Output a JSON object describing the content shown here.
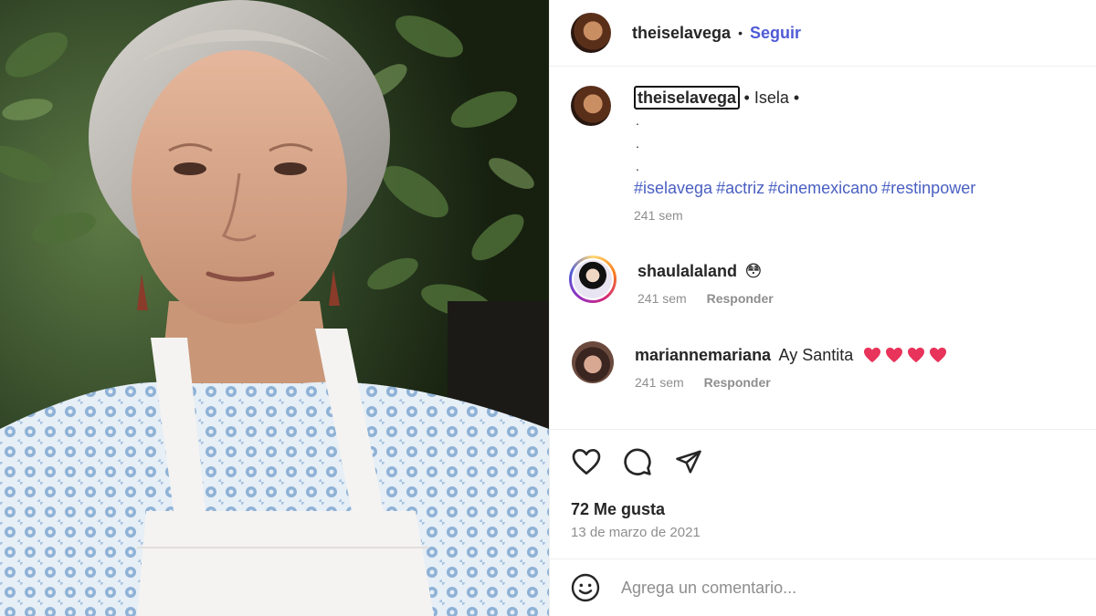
{
  "post": {
    "username": "theiselavega",
    "follow_label": "Seguir",
    "separator": "•"
  },
  "caption": {
    "username": "theiselavega",
    "text": "• Isela •",
    "dots": [
      ".",
      ".",
      "."
    ],
    "hashtags": [
      "#iselavega",
      "#actriz",
      "#cinemexicano",
      "#restinpower"
    ],
    "time": "241 sem"
  },
  "comments": [
    {
      "username": "shaulalaland",
      "text": "😳",
      "time": "241 sem",
      "reply_label": "Responder"
    },
    {
      "username": "mariannemariana",
      "text": "Ay Santita",
      "hearts": 4,
      "time": "241 sem",
      "reply_label": "Responder"
    }
  ],
  "actions": {
    "icons": [
      "heart-icon",
      "comment-icon",
      "share-icon"
    ],
    "likes": "72 Me gusta",
    "date": "13 de marzo de 2021"
  },
  "comment_box": {
    "placeholder": "Agrega un comentario...",
    "icon": "emoji-icon"
  },
  "colors": {
    "link": "#4f5bd5",
    "muted": "#8e8e8e",
    "heart_emoji": "#e8335a"
  }
}
